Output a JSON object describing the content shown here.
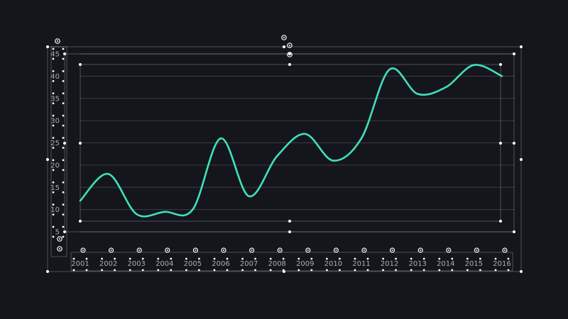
{
  "chart_data": {
    "type": "line",
    "title": "",
    "xlabel": "",
    "ylabel": "",
    "x": [
      "2001",
      "2002",
      "2003",
      "2004",
      "2005",
      "2006",
      "2007",
      "2008",
      "2009",
      "2010",
      "2011",
      "2012",
      "2013",
      "2014",
      "2015",
      "2016"
    ],
    "series": [
      {
        "values": [
          12,
          18,
          9,
          9.5,
          10,
          26,
          13,
          22,
          27,
          21,
          26,
          41.5,
          36,
          37.5,
          42.5,
          40
        ],
        "color": "#3fe0bf",
        "smooth": true
      }
    ],
    "ylim": [
      5,
      45
    ],
    "yticks": [
      5,
      10,
      15,
      20,
      25,
      30,
      35,
      40,
      45
    ],
    "grid": true,
    "legend": false
  },
  "colors": {
    "background": "#15161b",
    "line": "#3fe0bf",
    "grid": "#3a3d45",
    "tick_text": "#a9adb6",
    "handles": "#ffffff"
  },
  "editor": {
    "selection_handles_visible": true,
    "rotate_handle_icon": "rotate-handle-icon"
  }
}
